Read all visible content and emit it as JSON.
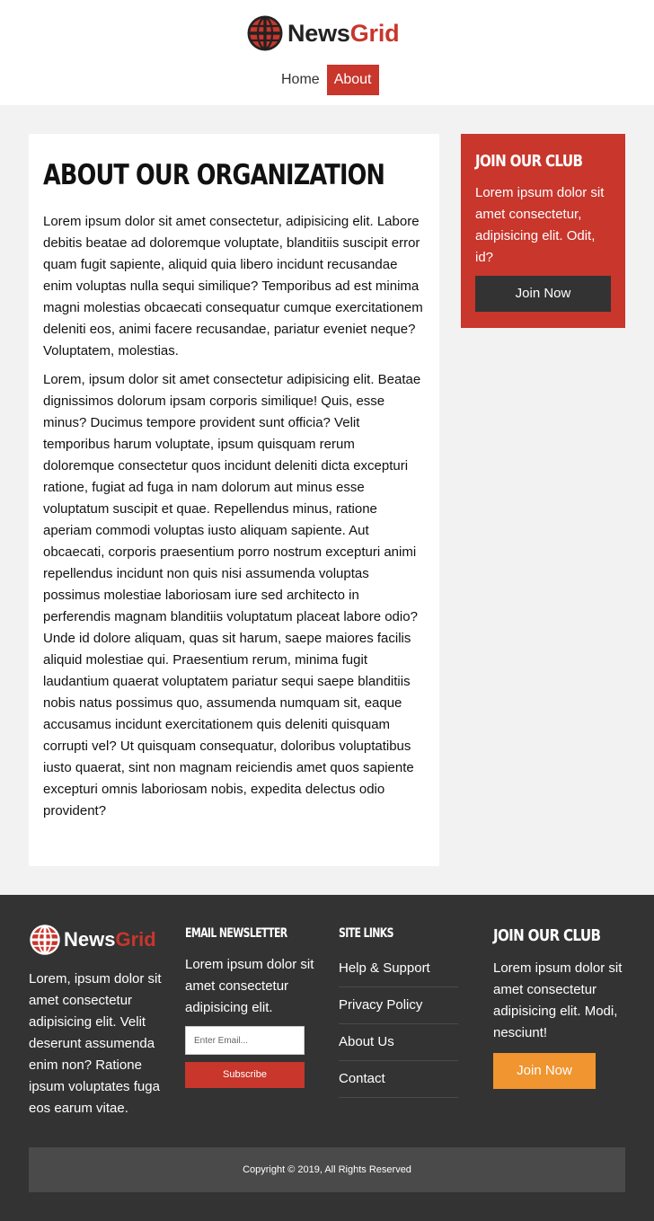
{
  "brand": {
    "name_part1": "News",
    "name_part2": "Grid",
    "accent_color": "#c8362c",
    "icon": "globe-icon"
  },
  "nav": {
    "items": [
      {
        "label": "Home"
      },
      {
        "label": "About"
      }
    ],
    "active": "About"
  },
  "article": {
    "title": "About Our Organization",
    "paragraphs": [
      "Lorem ipsum dolor sit amet consectetur, adipisicing elit. Labore debitis beatae ad doloremque voluptate, blanditiis suscipit error quam fugit sapiente, aliquid quia libero incidunt recusandae enim voluptas nulla sequi similique? Temporibus ad est minima magni molestias obcaecati consequatur cumque exercitationem deleniti eos, animi facere recusandae, pariatur eveniet neque? Voluptatem, molestias.",
      "Lorem, ipsum dolor sit amet consectetur adipisicing elit. Beatae dignissimos dolorum ipsam corporis similique! Quis, esse minus? Ducimus tempore provident sunt officia? Velit temporibus harum voluptate, ipsum quisquam rerum doloremque consectetur quos incidunt deleniti dicta excepturi ratione, fugiat ad fuga in nam dolorum aut minus esse voluptatum suscipit et quae. Repellendus minus, ratione aperiam commodi voluptas iusto aliquam sapiente. Aut obcaecati, corporis praesentium porro nostrum excepturi animi repellendus incidunt non quis nisi assumenda voluptas possimus molestiae laboriosam iure sed architecto in perferendis magnam blanditiis voluptatum placeat labore odio? Unde id dolore aliquam, quas sit harum, saepe maiores facilis aliquid molestiae qui. Praesentium rerum, minima fugit laudantium quaerat voluptatem pariatur sequi saepe blanditiis nobis natus possimus quo, assumenda numquam sit, eaque accusamus incidunt exercitationem quis deleniti quisquam corrupti vel? Ut quisquam consequatur, doloribus voluptatibus iusto quaerat, sint non magnam reiciendis amet quos sapiente excepturi omnis laboriosam nobis, expedita delectus odio provident?"
    ]
  },
  "sidebar_club": {
    "title": "Join Our Club",
    "text": "Lorem ipsum dolor sit amet consectetur, adipisicing elit. Odit, id?",
    "button": "Join Now",
    "bg_color": "#c8362c",
    "button_color": "#333333"
  },
  "footer": {
    "about": "Lorem, ipsum dolor sit amet consectetur adipisicing elit. Velit deserunt assumenda enim non? Ratione ipsum voluptates fuga eos earum vitae.",
    "newsletter": {
      "title": "Email Newsletter",
      "text": "Lorem ipsum dolor sit amet consectetur adipisicing elit.",
      "placeholder": "Enter Email...",
      "button": "Subscribe"
    },
    "links": {
      "title": "Site Links",
      "items": [
        {
          "label": "Help & Support"
        },
        {
          "label": "Privacy Policy"
        },
        {
          "label": "About Us"
        },
        {
          "label": "Contact"
        }
      ]
    },
    "club": {
      "title": "Join Our Club",
      "text": "Lorem ipsum dolor sit amet consectetur adipisicing elit. Modi, nesciunt!",
      "button": "Join Now",
      "button_color": "#f0952f"
    },
    "copyright": "Copyright © 2019, All Rights Reserved",
    "bg_color": "#333333"
  }
}
